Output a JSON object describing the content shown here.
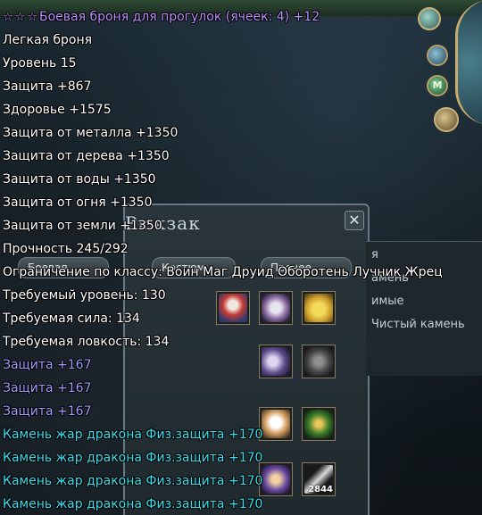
{
  "tooltip": {
    "title": {
      "stars": [
        "☆",
        "☆",
        "☆"
      ],
      "text": "Боевая броня для прогулок (ячеек: 4) +12",
      "color": "#b98cff"
    },
    "lines": [
      {
        "text": "Легкая броня",
        "color": "white"
      },
      {
        "text": "Уровень 15",
        "color": "white"
      },
      {
        "text": "Защита +867",
        "color": "white"
      },
      {
        "text": "Здоровье +1575",
        "color": "white"
      },
      {
        "text": "Защита от металла +1350",
        "color": "white"
      },
      {
        "text": "Защита от дерева +1350",
        "color": "white"
      },
      {
        "text": "Защита от воды +1350",
        "color": "white"
      },
      {
        "text": "Защита от огня +1350",
        "color": "white"
      },
      {
        "text": "Защита от земли +1350",
        "color": "white"
      },
      {
        "text": "Прочность 245/292",
        "color": "white"
      },
      {
        "text": "Ограничение по классу: Воин Маг Друид Оборотень Лучник Жрец",
        "color": "white"
      },
      {
        "text": "Требуемый уровень: 130",
        "color": "white"
      },
      {
        "text": "Требуемая сила: 134",
        "color": "white"
      },
      {
        "text": "Требуемая ловкость: 134",
        "color": "white"
      },
      {
        "text": "Защита +167",
        "color": "blue"
      },
      {
        "text": "Защита +167",
        "color": "blue"
      },
      {
        "text": "Защита +167",
        "color": "blue"
      },
      {
        "text": "Камень жар дракона Физ.защита +170",
        "color": "cyan"
      },
      {
        "text": "Камень жар дракона Физ.защита +170",
        "color": "cyan"
      },
      {
        "text": "Камень жар дракона Физ.защита +170",
        "color": "cyan"
      },
      {
        "text": "Камень жар дракона Физ.защита +170",
        "color": "cyan"
      }
    ]
  },
  "background": {
    "panel_title": "Рюкзак",
    "close_glyph": "✕",
    "tabs": [
      "Боевая",
      "Костюм",
      "Прочее"
    ],
    "right_text": [
      "я",
      "амень",
      "имые",
      "Чистый камень"
    ],
    "slot_count": "2844",
    "minimap_button": "M"
  },
  "colors": {
    "white": "#ffffff",
    "blue": "#9f9cff",
    "cyan": "#35e0f0",
    "purple": "#b98cff"
  }
}
